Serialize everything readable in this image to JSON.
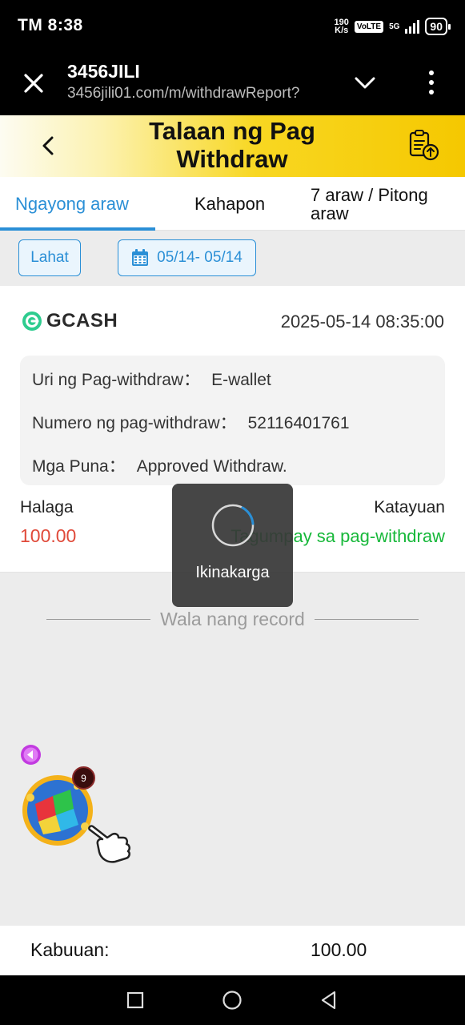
{
  "status_bar": {
    "time": "TM 8:38",
    "net_speed_value": "190",
    "net_speed_unit": "K/s",
    "volte": "VoLTE",
    "network": "5G",
    "battery": "90"
  },
  "browser": {
    "title": "3456JILI",
    "url": "3456jili01.com/m/withdrawReport?"
  },
  "header": {
    "title": "Talaan ng Pag Withdraw"
  },
  "tabs": [
    {
      "label": "Ngayong araw",
      "active": true
    },
    {
      "label": "Kahapon",
      "active": false
    },
    {
      "label": "7 araw / Pitong araw",
      "active": false
    }
  ],
  "filters": {
    "all_label": "Lahat",
    "date_range": "05/14- 05/14"
  },
  "record": {
    "brand": "GCASH",
    "datetime": "2025-05-14 08:35:00",
    "details": [
      {
        "label": "Uri ng Pag-withdraw：",
        "value": "E-wallet"
      },
      {
        "label": "Numero ng pag-withdraw：",
        "value": "52116401761"
      },
      {
        "label": "Mga Puna：",
        "value": "Approved Withdraw."
      }
    ],
    "amount_label": "Halaga",
    "amount": "100.00",
    "status_label": "Katayuan",
    "status": "Tagumpay sa pag-withdraw"
  },
  "no_more": "Wala nang record",
  "loading_text": "Ikinakarga",
  "widget": {
    "badge_count": "9"
  },
  "total": {
    "label": "Kabuuan:",
    "value": "100.00"
  },
  "colors": {
    "accent": "#2a8fd6",
    "amount": "#e04a3a",
    "success": "#17b83a",
    "header_yellow": "#f5c800"
  }
}
